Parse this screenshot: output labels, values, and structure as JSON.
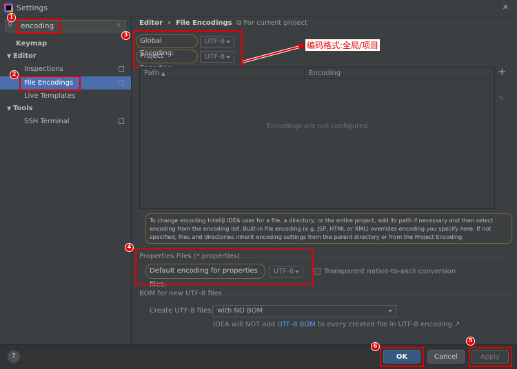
{
  "window": {
    "title": "Settings",
    "close": "✕"
  },
  "sidebar": {
    "search_value": "encoding",
    "search_clear": "✕",
    "items": [
      {
        "label": "Keymap"
      },
      {
        "label": "Editor"
      },
      {
        "label": "Inspections"
      },
      {
        "label": "File Encodings",
        "selected": true
      },
      {
        "label": "Live Templates"
      },
      {
        "label": "Tools"
      },
      {
        "label": "SSH Terminal"
      }
    ]
  },
  "breadcrumb": {
    "parent": "Editor",
    "sep": "›",
    "current": "File Encodings",
    "scope": "For current project"
  },
  "encodings": {
    "global_label": "Global Encoding:",
    "global_value": "UTF-8",
    "project_label": "Project Encoding:",
    "project_value": "UTF-8"
  },
  "annotation": "编码格式:全局/项目",
  "table": {
    "col_path": "Path",
    "sort_icon": "▲",
    "col_encoding": "Encoding",
    "empty": "Encodings are not configured",
    "add": "+"
  },
  "info": "To change encoding IntelliJ IDEA uses for a file, a directory, or the entire project, add its path if necessary and then select encoding from the encoding list. Built-in file encoding (e.g. JSP, HTML or XML) overrides encoding you specify here. If not specified, files and directories inherit encoding settings from the parent directory or from the Project Encoding.",
  "properties": {
    "header": "Properties Files (*.properties)",
    "label": "Default encoding for properties files:",
    "value": "UTF-8",
    "checkbox_label": "Transparent native-to-ascii conversion",
    "checked": false
  },
  "bom": {
    "header": "BOM for new UTF-8 files",
    "label": "Create UTF-8 files:",
    "value": "with NO BOM",
    "note_pre": "IDEA will NOT add ",
    "note_link": "UTF-8 BOM",
    "note_post": " to every created file in UTF-8 encoding ↗"
  },
  "footer": {
    "help": "?",
    "ok": "OK",
    "cancel": "Cancel",
    "apply": "Apply"
  },
  "badges": [
    "1",
    "2",
    "3",
    "4",
    "5",
    "6"
  ],
  "colors": {
    "selection": "#4b6eaf",
    "highlight": "#e60000",
    "link": "#589df6"
  }
}
